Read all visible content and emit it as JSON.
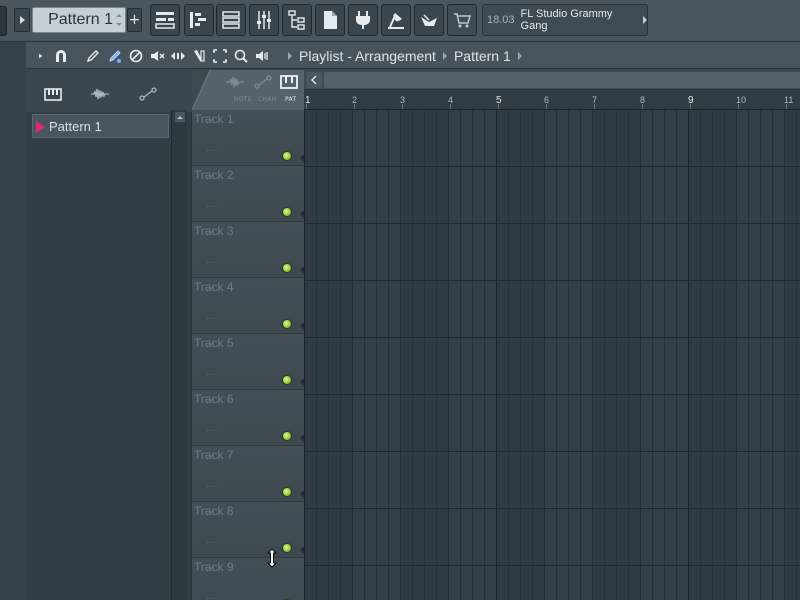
{
  "toolbar": {
    "pattern_selector": {
      "label": "Pattern 1"
    },
    "add_button_label": "+",
    "hint": {
      "time": "18.03",
      "title": "FL Studio Grammy Gang"
    },
    "icons": [
      "playlist-icon",
      "piano-roll-icon",
      "channel-rack-icon",
      "mixer-icon",
      "browser-icon",
      "plugin-picker-icon",
      "plugin-database-icon",
      "manual-icon",
      "project-picker-icon",
      "shop-icon"
    ]
  },
  "window": {
    "breadcrumb": [
      "Playlist - Arrangement",
      "Pattern 1"
    ],
    "tools": [
      "menu-arrow-icon",
      "magnet-icon",
      "draw-icon",
      "paint-icon",
      "delete-icon",
      "mute-icon",
      "slip-icon",
      "slice-icon",
      "select-icon",
      "zoom-icon",
      "playback-icon"
    ]
  },
  "picker": {
    "tabs": [
      "pattern-clips-tab",
      "audio-clips-tab",
      "automation-clips-tab"
    ],
    "items": [
      {
        "label": "Pattern 1",
        "color": "#e2266b"
      }
    ]
  },
  "track_header": {
    "filters": [
      "NOTE",
      "CHAN",
      "PAT"
    ],
    "active_filter": "PAT"
  },
  "tracks": [
    {
      "name": "Track 1",
      "placeholder": "...",
      "enabled": true
    },
    {
      "name": "Track 2",
      "placeholder": "...",
      "enabled": true
    },
    {
      "name": "Track 3",
      "placeholder": "...",
      "enabled": true
    },
    {
      "name": "Track 4",
      "placeholder": "...",
      "enabled": true
    },
    {
      "name": "Track 5",
      "placeholder": "...",
      "enabled": true
    },
    {
      "name": "Track 6",
      "placeholder": "...",
      "enabled": true
    },
    {
      "name": "Track 7",
      "placeholder": "...",
      "enabled": true
    },
    {
      "name": "Track 8",
      "placeholder": "...",
      "enabled": true
    },
    {
      "name": "Track 9",
      "placeholder": "...",
      "enabled": true
    }
  ],
  "ruler": {
    "bars": [
      "1",
      "2",
      "3",
      "4",
      "5",
      "6",
      "7",
      "8",
      "9",
      "10",
      "11"
    ],
    "major_bars": [
      "1",
      "5",
      "9"
    ]
  },
  "colors": {
    "accent_pattern": "#e2266b",
    "led_on": "#8fcf3a",
    "background": "#34404a"
  }
}
